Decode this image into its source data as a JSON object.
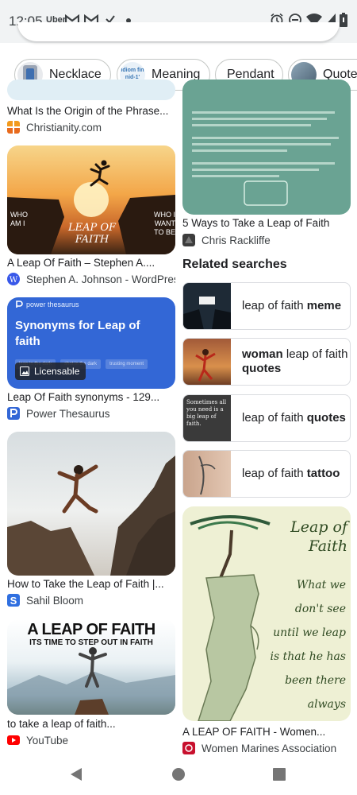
{
  "status_bar": {
    "time": "12:05",
    "app_uber": "Uber",
    "icons": [
      "gmail-icon",
      "gmail-icon",
      "download-done-icon",
      "dot-icon",
      "alarm-icon",
      "do-not-disturb-icon",
      "wifi-icon",
      "signal-icon",
      "battery-icon"
    ]
  },
  "chips": [
    {
      "label": "Necklace"
    },
    {
      "label": "Meaning",
      "thumb_text": "idiom fin nid-1'"
    },
    {
      "label": "Pendant"
    },
    {
      "label": "Quote"
    }
  ],
  "left_column": [
    {
      "title": "What Is the Origin of the Phrase...",
      "source": "Christianity.com"
    },
    {
      "title": "A Leap Of Faith – Stephen A....",
      "source": "Stephen A. Johnson - WordPress",
      "image_text_left": "WHO AM I",
      "image_text_center": "LEAP OF FAITH",
      "image_text_right": "WHO I WANT TO BE"
    },
    {
      "title": "Leap Of Faith synonyms - 129...",
      "source": "Power Thesaurus",
      "card_brand": "power thesaurus",
      "card_heading": "Synonyms for Leap of faith",
      "card_tags": [
        "leap in the dark",
        "shot in the dark",
        "trusting moment"
      ],
      "badge": "Licensable"
    },
    {
      "title": "How to Take the Leap of Faith |...",
      "source": "Sahil Bloom"
    },
    {
      "title": "to take a leap of faith...",
      "source": "YouTube",
      "image_headline": "A LEAP OF FAITH",
      "image_subline": "ITS TIME TO STEP OUT IN FAITH"
    }
  ],
  "right_column": [
    {
      "title": "5 Ways to Take a Leap of Faith",
      "source": "Chris Rackliffe"
    },
    {
      "title": "A LEAP OF FAITH - Women...",
      "source": "Women Marines Association",
      "image_quote": [
        "Leap of",
        "Faith",
        "What we",
        "don't see",
        "until we leap",
        "is that he has",
        "been there",
        "always"
      ]
    }
  ],
  "related": {
    "heading": "Related searches",
    "items": [
      {
        "normal": "leap of faith ",
        "bold": "meme"
      },
      {
        "bold1": "woman",
        "normal": " leap of faith ",
        "bold2": "quotes"
      },
      {
        "normal": "leap of faith ",
        "bold": "quotes",
        "thumb_text": "Sometimes all you need is a big leap of faith."
      },
      {
        "normal": "leap of faith ",
        "bold": "tattoo"
      }
    ]
  },
  "colors": {
    "thesaurus_blue": "#3367d6",
    "teal_card": "#6aa393",
    "chip_border": "#c4c7c5"
  }
}
